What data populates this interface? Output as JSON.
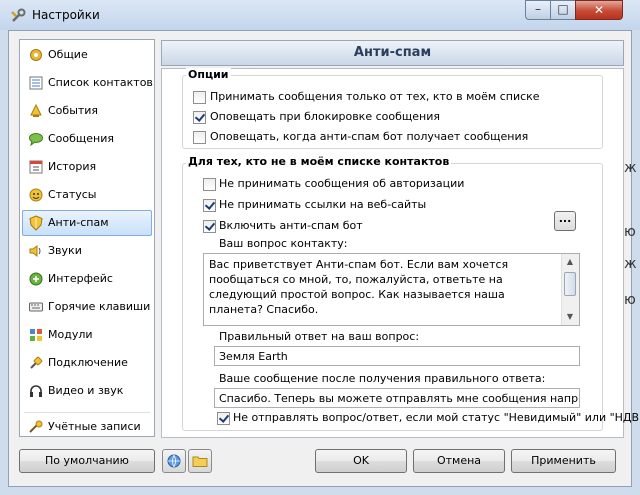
{
  "window": {
    "title": "Настройки",
    "close_symbol": "✕",
    "min_symbol": "–",
    "max_symbol": "□"
  },
  "sidebar": {
    "items": [
      {
        "label": "Общие",
        "icon": "gear-icon"
      },
      {
        "label": "Список контактов",
        "icon": "contacts-icon"
      },
      {
        "label": "События",
        "icon": "events-icon"
      },
      {
        "label": "Сообщения",
        "icon": "messages-icon"
      },
      {
        "label": "История",
        "icon": "history-icon"
      },
      {
        "label": "Статусы",
        "icon": "status-icon"
      },
      {
        "label": "Анти-спам",
        "icon": "shield-icon",
        "selected": true
      },
      {
        "label": "Звуки",
        "icon": "speaker-icon"
      },
      {
        "label": "Интерфейс",
        "icon": "interface-icon"
      },
      {
        "label": "Горячие клавиши",
        "icon": "hotkeys-icon"
      },
      {
        "label": "Модули",
        "icon": "modules-icon"
      },
      {
        "label": "Подключение",
        "icon": "connection-icon"
      },
      {
        "label": "Видео и звук",
        "icon": "headset-icon"
      },
      {
        "label": "Учётные записи",
        "icon": "accounts-icon"
      }
    ]
  },
  "panel": {
    "title": "Анти-спам",
    "options": {
      "title": "Опции",
      "items": [
        {
          "label": "Принимать сообщения только от тех, кто в моём списке",
          "checked": false
        },
        {
          "label": "Оповещать при блокировке сообщения",
          "checked": true
        },
        {
          "label": "Оповещать, когда анти-спам бот получает сообщения",
          "checked": false
        }
      ]
    },
    "nonlist": {
      "title": "Для тех, кто не в моём списке контактов",
      "items": [
        {
          "label": "Не принимать сообщения об авторизации",
          "checked": false
        },
        {
          "label": "Не принимать ссылки на веб-сайты",
          "checked": true
        },
        {
          "label": "Включить анти-спам бот",
          "checked": true
        }
      ],
      "more_button": "...",
      "question_label": "Ваш вопрос контакту:",
      "question_text": "Вас приветствует Анти-спам бот. Если вам хочется пообщаться со мной, то, пожалуйста, ответьте на следующий простой вопрос. Как называется наша планета? Спасибо.\n\nHello. This is my Anti-spam control. If you would like to chat with me",
      "answer_label": "Правильный ответ на ваш вопрос:",
      "answer_value": "Земля Earth",
      "after_label": "Ваше сообщение после получения правильного ответа:",
      "after_value": "Спасибо. Теперь вы можете отправлять мне сообщения напрямую. Th",
      "noinvisible": {
        "label": "Не отправлять вопрос/ответ, если мой статус \"Невидимый\" или \"НДВ\"",
        "checked": true
      }
    }
  },
  "footer": {
    "default_button": "По умолчанию",
    "ok_button": "OK",
    "cancel_button": "Отмена",
    "apply_button": "Применить"
  },
  "right_edge_fragments": [
    "ж",
    "ю",
    "ж",
    "ю"
  ]
}
